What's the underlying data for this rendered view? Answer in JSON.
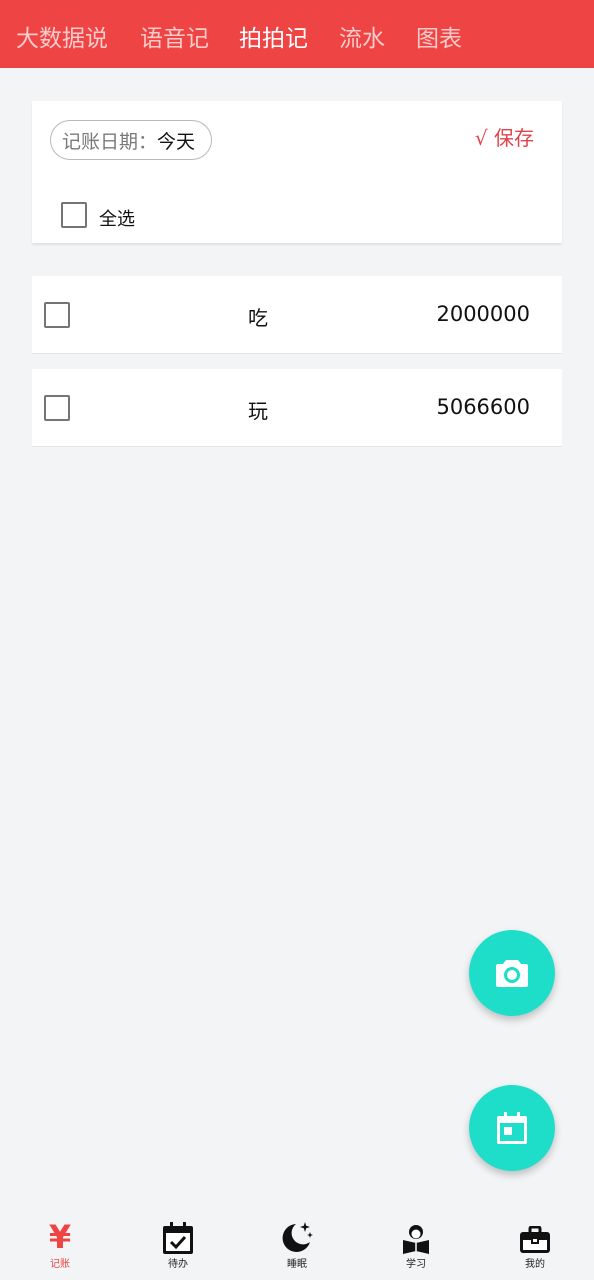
{
  "top_tabs": [
    {
      "label": "大数据说",
      "active": false
    },
    {
      "label": "语音记",
      "active": false
    },
    {
      "label": "拍拍记",
      "active": true
    },
    {
      "label": "流水",
      "active": false
    },
    {
      "label": "图表",
      "active": false
    }
  ],
  "header": {
    "date_label": "记账日期：",
    "date_value": "今天",
    "save_label": "√ 保存",
    "select_all_label": "全选"
  },
  "records": [
    {
      "category": "吃",
      "amount": "2000000",
      "checked": false
    },
    {
      "category": "玩",
      "amount": "5066600",
      "checked": false
    }
  ],
  "fabs": [
    {
      "icon": "camera-icon"
    },
    {
      "icon": "calendar-icon"
    }
  ],
  "bottom_nav": [
    {
      "label": "记账",
      "icon": "yuan-icon",
      "active": true
    },
    {
      "label": "待办",
      "icon": "calendar-check-icon",
      "active": false
    },
    {
      "label": "睡眠",
      "icon": "moon-stars-icon",
      "active": false
    },
    {
      "label": "学习",
      "icon": "reading-person-icon",
      "active": false
    },
    {
      "label": "我的",
      "icon": "toolbox-icon",
      "active": false
    }
  ],
  "colors": {
    "brand": "#ef4444",
    "fab": "#1fdec9",
    "save": "#e0434b"
  }
}
